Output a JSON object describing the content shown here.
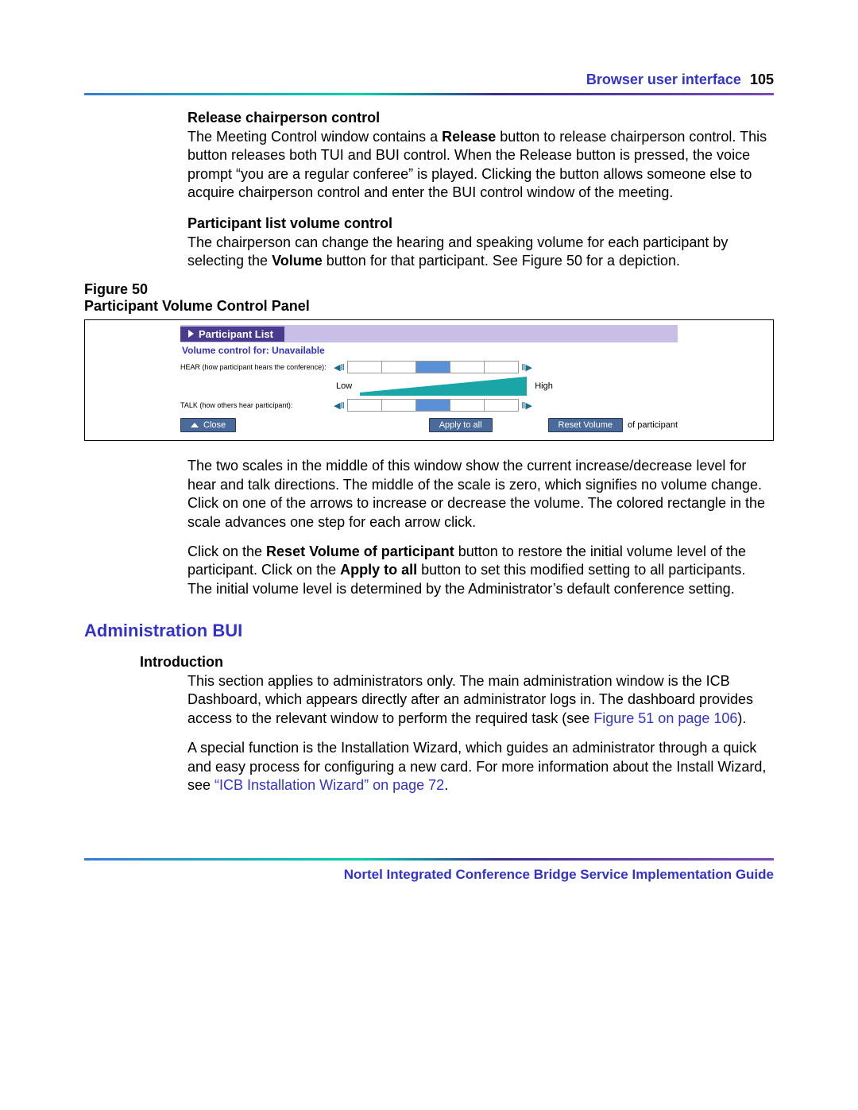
{
  "header": {
    "section": "Browser user interface",
    "page": "105"
  },
  "sec1": {
    "title": "Release chairperson control",
    "para_a": "The Meeting Control window contains a ",
    "bold_a": "Release",
    "para_b": " button to release chairperson control. This button releases both TUI and BUI control. When the Release button is pressed, the voice prompt “you are a regular conferee” is played. Clicking the button allows someone else to acquire chairperson control and enter the BUI control window of the meeting."
  },
  "sec2": {
    "title": "Participant list volume control",
    "para_a": "The chairperson can change the hearing and speaking volume for each participant by selecting the ",
    "bold_a": "Volume",
    "para_b": " button for that participant. See Figure 50 for a depiction."
  },
  "figure": {
    "label_line1": "Figure 50",
    "label_line2": "Participant Volume Control Panel",
    "panel": {
      "title": "Participant List",
      "vc_for": "Volume control for:  Unavailable",
      "hear_label": "HEAR (how participant hears the conference):",
      "talk_label": "TALK (how others hear participant):",
      "low": "Low",
      "high": "High",
      "close": "Close",
      "apply": "Apply to all",
      "reset": "Reset Volume",
      "of_participant": "of participant"
    }
  },
  "post1": "The two scales in the middle of this window show the current increase/decrease level for hear and talk directions. The middle of the scale is zero, which signifies no volume change. Click on one of the arrows to increase or decrease the volume. The colored rectangle in the scale advances one step for each arrow click.",
  "post2_a": "Click on the ",
  "post2_bold1": "Reset Volume of participant",
  "post2_b": " button to restore the initial volume level of the participant. Click on the ",
  "post2_bold2": "Apply to all",
  "post2_c": " button to set this modified setting to all participants. The initial volume level is determined by the Administrator’s default conference setting.",
  "admin": {
    "heading": "Administration BUI",
    "intro_title": "Introduction",
    "p1_a": "This section applies to administrators only. The main administration window is the ICB Dashboard, which appears directly after an administrator logs in. The dashboard provides access to the relevant window to perform the required task (see ",
    "p1_link": "Figure 51 on page 106",
    "p1_b": ").",
    "p2_a": "A special function is the Installation Wizard, which guides an administrator through a quick and easy process for configuring a new card. For more information about the Install Wizard, see ",
    "p2_link": "“ICB Installation Wizard” on page 72",
    "p2_b": "."
  },
  "footer": "Nortel Integrated Conference Bridge Service Implementation Guide"
}
